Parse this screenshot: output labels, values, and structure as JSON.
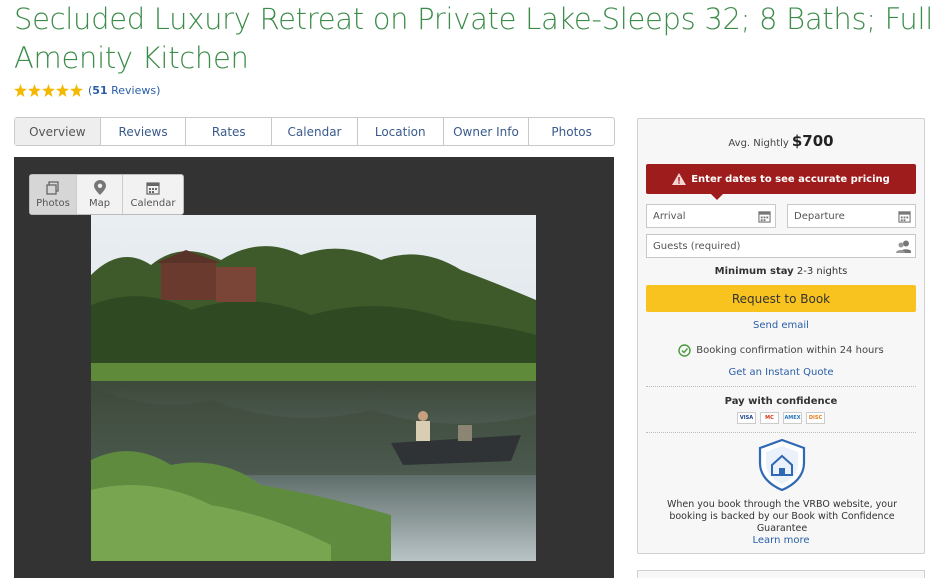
{
  "listing": {
    "title": "Secluded Luxury Retreat on Private Lake-Sleeps 32; 8 Baths; Full Amenity Kitchen",
    "rating_stars": 5,
    "reviews_count": "51",
    "reviews_word": "Reviews"
  },
  "tabs": [
    "Overview",
    "Reviews",
    "Rates",
    "Calendar",
    "Location",
    "Owner Info",
    "Photos"
  ],
  "gallery": {
    "view_tabs": [
      {
        "label": "Photos",
        "icon": "photos-icon"
      },
      {
        "label": "Map",
        "icon": "map-pin-icon"
      },
      {
        "label": "Calendar",
        "icon": "calendar-icon"
      }
    ]
  },
  "booking": {
    "price_label": "Avg. Nightly",
    "price_value": "$700",
    "alert_text": "Enter dates to see accurate pricing",
    "arrival_placeholder": "Arrival",
    "departure_placeholder": "Departure",
    "guests_placeholder": "Guests (required)",
    "min_stay_label": "Minimum stay",
    "min_stay_value": "2-3 nights",
    "book_button": "Request to Book",
    "send_email": "Send email",
    "confirmation_text": "Booking confirmation within 24 hours",
    "instant_quote": "Get an Instant Quote",
    "pay_title": "Pay with confidence",
    "cards": [
      "VISA",
      "MC",
      "AMEX",
      "DISC"
    ],
    "guarantee_text": "When you book through the VRBO website, your booking is backed by our Book with Confidence Guarantee",
    "learn_more": "Learn more"
  },
  "colors": {
    "title_green": "#3c8c4a",
    "alert_red": "#9e1c1c",
    "book_yellow": "#f8c31e",
    "link_blue": "#2a5ea8",
    "star_gold": "#f5b800"
  }
}
